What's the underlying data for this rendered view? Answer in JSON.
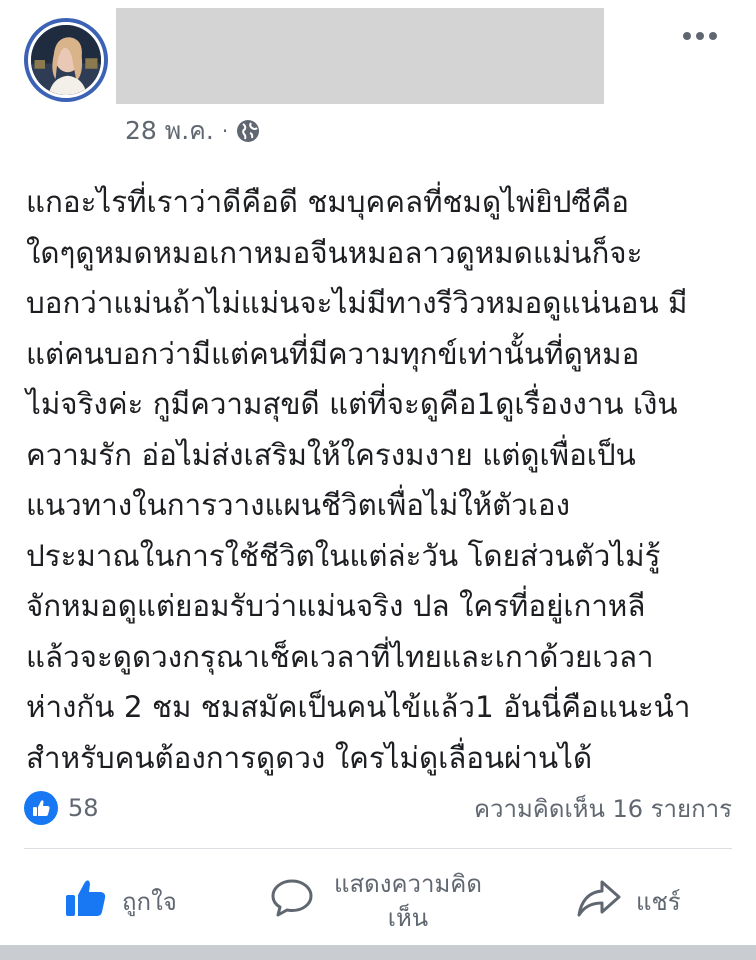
{
  "post": {
    "author_name": "",
    "timestamp": "28 พ.ค.",
    "separator": "·",
    "privacy_icon": "globe-icon",
    "body_lines": [
      "แกอะไรที่เราว่าดีคือดี ชมบุคคลที่ชมดูไพ่ยิปซีคือ",
      "ใดๆดูหมดหมอเกาหมอจีนหมอลาวดูหมดแม่นก็จะ",
      "บอกว่าแม่นถ้าไม่แม่นจะไม่มีทางรีวิวหมอดูแน่นอน มี",
      "แต่คนบอกว่ามีแต่คนที่มีความทุกข์เท่านั้นที่ดูหมอ",
      "ไม่จริงค่ะ กูมีความสุขดี แต่ที่จะดูคือ1ดูเรื่องงาน เงิน",
      "ความรัก อ่อไม่ส่งเสริมให้ใครงมงาย แต่ดูเพื่อเป็น",
      "แนวทางในการวางแผนชีวิตเพื่อไม่ให้ตัวเอง",
      "ประมาณในการใช้ชีวิตในแต่ล่ะวัน โดยส่วนตัวไม่รู้",
      "จักหมอดูแต่ยอมรับว่าแม่นจริง ปล ใครที่อยู่เกาหลี",
      "แล้วจะดูดวงกรุณาเช็คเวลาที่ไทยและเกาด้วยเวลา",
      "ห่างกัน 2 ชม ชมสมัคเป็นคนไข้แล้ว1 อันนี่คือแนะนำ",
      "สำหรับคนต้องการดูดวง ใครไม่ดูเลื่อนผ่านได้"
    ]
  },
  "stats": {
    "like_count": "58",
    "comments_label": "ความคิดเห็น 16 รายการ"
  },
  "actions": {
    "like_label": "ถูกใจ",
    "comment_label": "แสดงความคิด\nเห็น",
    "share_label": "แชร์"
  },
  "colors": {
    "accent": "#1877f2",
    "secondary_text": "#606770",
    "redaction": "#d4d4d4",
    "avatar_ring": "#3b62b5"
  }
}
